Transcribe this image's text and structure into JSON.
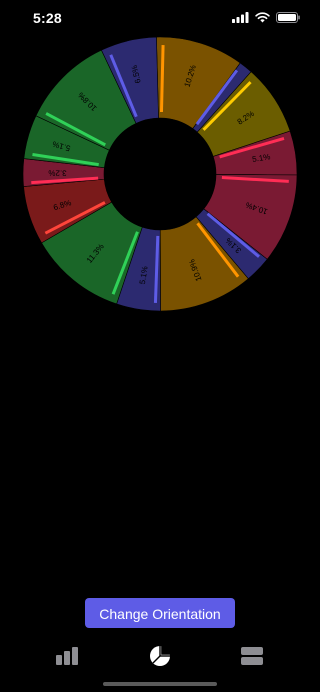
{
  "status_bar": {
    "time": "5:28",
    "icons": [
      "signal-bars-icon",
      "wifi-icon",
      "battery-icon"
    ]
  },
  "chart_data": {
    "type": "pie",
    "style": "donut",
    "series": [
      {
        "label": "10.2%",
        "value": 10.2,
        "color": "#7a5200",
        "accent": "#ff9500"
      },
      {
        "label": "",
        "value": 1.6,
        "color": "#2c2a70",
        "accent": "#5e5ce6"
      },
      {
        "label": "8.2%",
        "value": 8.2,
        "color": "#6b5d00",
        "accent": "#ffcc00"
      },
      {
        "label": "5.1%",
        "value": 5.1,
        "color": "#7a1a33",
        "accent": "#ff2d55"
      },
      {
        "label": "10.4%",
        "value": 10.4,
        "color": "#7a1a33",
        "accent": "#ff2d55"
      },
      {
        "label": "3.1%",
        "value": 3.1,
        "color": "#2c2a70",
        "accent": "#5e5ce6"
      },
      {
        "label": "10.9%",
        "value": 10.9,
        "color": "#7a5200",
        "accent": "#ff9500"
      },
      {
        "label": "5.1%",
        "value": 5.1,
        "color": "#2c2a70",
        "accent": "#5e5ce6"
      },
      {
        "label": "11.3%",
        "value": 11.3,
        "color": "#1a6628",
        "accent": "#30d158"
      },
      {
        "label": "6.8%",
        "value": 6.8,
        "color": "#7a1a1a",
        "accent": "#ff453a"
      },
      {
        "label": "3.2%",
        "value": 3.2,
        "color": "#7a1a33",
        "accent": "#ff2d55"
      },
      {
        "label": "5.1%",
        "value": 5.1,
        "color": "#1a6628",
        "accent": "#30d158"
      },
      {
        "label": "10.8%",
        "value": 10.8,
        "color": "#1a6628",
        "accent": "#30d158"
      },
      {
        "label": "6.5%",
        "value": 6.5,
        "color": "#2c2a70",
        "accent": "#5e5ce6"
      }
    ]
  },
  "button": {
    "label": "Change Orientation"
  },
  "tab_bar": {
    "tabs": [
      {
        "icon": "bar-chart-icon",
        "active": false
      },
      {
        "icon": "pie-chart-icon",
        "active": true
      },
      {
        "icon": "stacked-rows-icon",
        "active": false
      }
    ]
  },
  "colors": {
    "accent": "#5e5ce6",
    "background": "#000000"
  }
}
